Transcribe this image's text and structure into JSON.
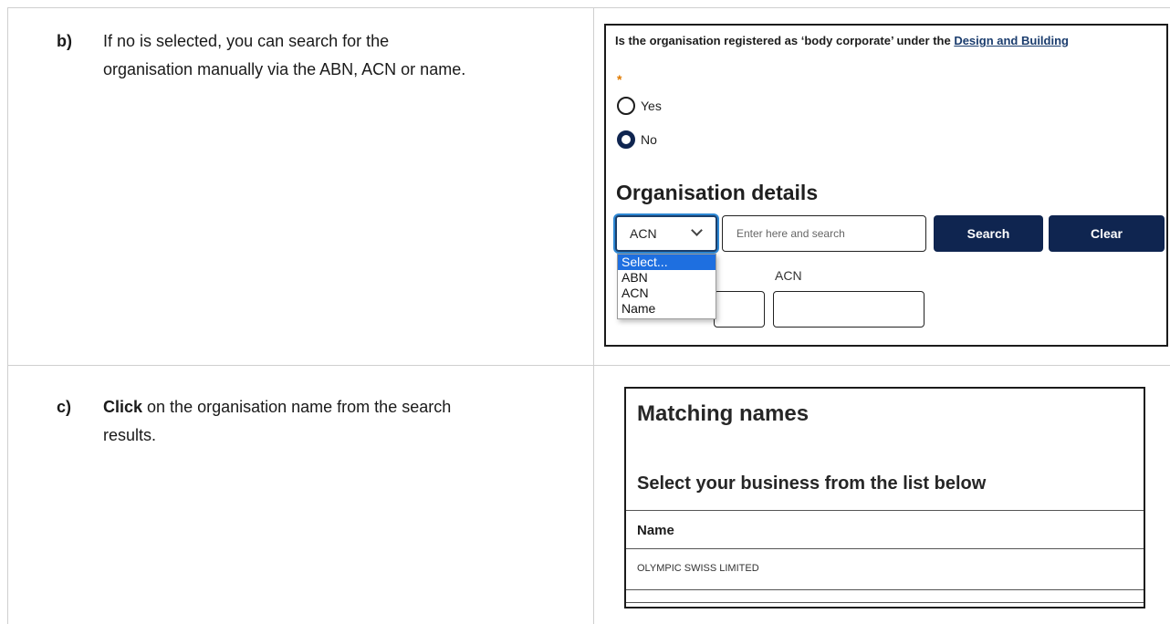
{
  "step_b": {
    "letter": "b)",
    "line1": "If no is selected, you can search for the",
    "line2": "organisation manually via the ABN, ACN or name."
  },
  "step_c": {
    "letter": "c)",
    "bold": "Click",
    "line1_rest": " on the organisation name from the search",
    "line2": "results."
  },
  "form": {
    "question": "Is the organisation registered as ‘body corporate’ under the ",
    "question_link": "Design and Building",
    "required_marker": "*",
    "radio_yes": "Yes",
    "radio_no": "No",
    "selected_radio": "No",
    "section_title": "Organisation details",
    "search_type_value": "ACN",
    "search_placeholder": "Enter here and search",
    "search_button": "Search",
    "clear_button": "Clear",
    "acn_label": "ACN",
    "dropdown_options": [
      "Select...",
      "ABN",
      "ACN",
      "Name"
    ],
    "dropdown_highlighted": "Select..."
  },
  "results": {
    "title": "Matching names",
    "subtitle": "Select your business from the list below",
    "column_header": "Name",
    "rows": [
      "OLYMPIC SWISS LIMITED"
    ]
  },
  "colors": {
    "primary_navy": "#0f2550",
    "link": "#1b3d6e",
    "required": "#e07a00",
    "highlight": "#1e6fe0",
    "focus_ring": "#2e88d4"
  }
}
